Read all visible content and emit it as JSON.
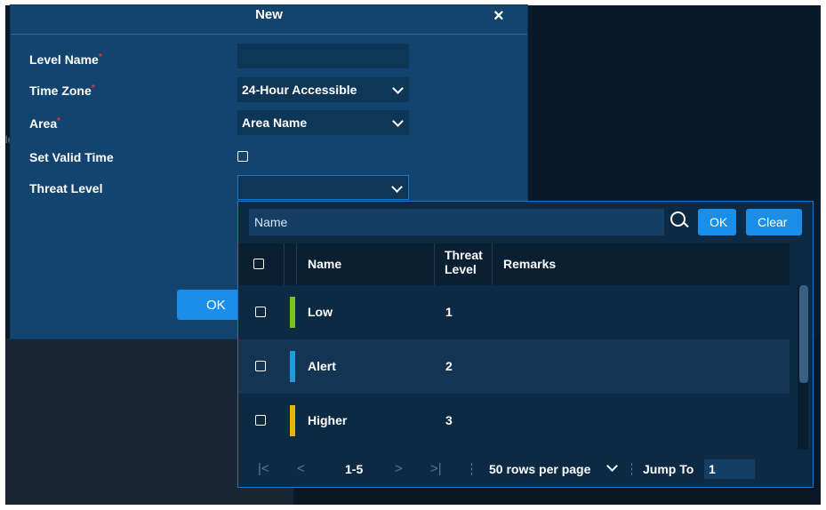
{
  "dialog": {
    "title": "New",
    "close_glyph": "×",
    "fields": {
      "level_name": {
        "label": "Level Name",
        "required": "*",
        "value": ""
      },
      "time_zone": {
        "label": "Time Zone",
        "required": "*",
        "value": "24-Hour Accessible"
      },
      "area": {
        "label": "Area",
        "required": "*",
        "value": "Area Name"
      },
      "set_valid_time": {
        "label": "Set Valid Time"
      },
      "threat_level": {
        "label": "Threat Level",
        "value": ""
      }
    },
    "ok_label": "OK"
  },
  "background": {
    "sliver_text": "le"
  },
  "popup": {
    "search_placeholder": "Name",
    "ok_label": "OK",
    "clear_label": "Clear",
    "columns": {
      "name": "Name",
      "threat_level_1": "Threat",
      "threat_level_2": "Level",
      "remarks": "Remarks"
    },
    "rows": [
      {
        "name": "Low",
        "level": "1",
        "remarks": "",
        "color": "#7cc322"
      },
      {
        "name": "Alert",
        "level": "2",
        "remarks": "",
        "color": "#1e9be0"
      },
      {
        "name": "Higher",
        "level": "3",
        "remarks": "",
        "color": "#e6b300"
      }
    ],
    "pager": {
      "first": "|<",
      "prev": "<",
      "range": "1-5",
      "next": ">",
      "last": ">|",
      "rows_per_page": "50 rows per page",
      "jump_label": "Jump To",
      "jump_value": "1"
    }
  },
  "icons": [
    "close-icon",
    "chevron-down-icon",
    "checkbox-icon",
    "search-icon"
  ],
  "colors": {
    "accent": "#1a8ee8",
    "dialog_bg": "#12446f",
    "popup_border": "#1c74c4"
  }
}
